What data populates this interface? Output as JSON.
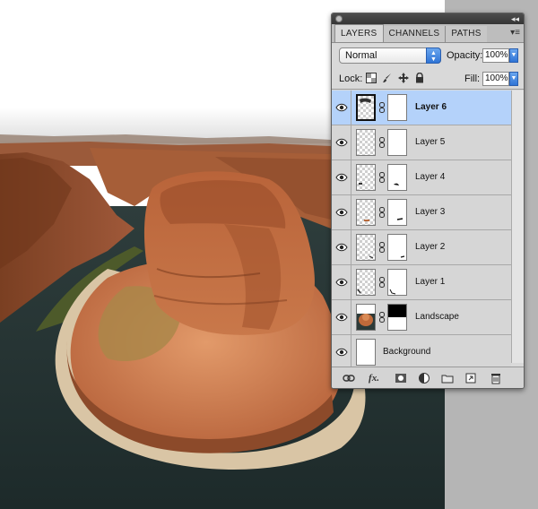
{
  "panel": {
    "tabs": [
      "LAYERS",
      "CHANNELS",
      "PATHS"
    ],
    "active_tab": "LAYERS",
    "blend_mode": "Normal",
    "opacity_label": "Opacity:",
    "opacity_value": "100%",
    "lock_label": "Lock:",
    "fill_label": "Fill:",
    "fill_value": "100%",
    "layers": [
      {
        "name": "Layer 6",
        "selected": true,
        "thumb": "transparent",
        "mask": true
      },
      {
        "name": "Layer 5",
        "selected": false,
        "thumb": "transparent",
        "mask": true
      },
      {
        "name": "Layer 4",
        "selected": false,
        "thumb": "transparent",
        "mask": true
      },
      {
        "name": "Layer 3",
        "selected": false,
        "thumb": "transparent",
        "mask": true
      },
      {
        "name": "Layer 2",
        "selected": false,
        "thumb": "transparent",
        "mask": true
      },
      {
        "name": "Layer 1",
        "selected": false,
        "thumb": "transparent",
        "mask": true
      },
      {
        "name": "Landscape",
        "selected": false,
        "thumb": "image",
        "mask": true
      },
      {
        "name": "Background",
        "selected": false,
        "thumb": "white",
        "mask": false
      }
    ],
    "footer_icons": [
      "link-layers-icon",
      "fx-icon",
      "add-mask-icon",
      "adjustment-layer-icon",
      "new-group-icon",
      "new-layer-icon",
      "trash-icon"
    ]
  },
  "colors": {
    "selection": "#b4d2fa",
    "panel_bg": "#d9d9d9",
    "accent_blue": "#2f74d6"
  }
}
